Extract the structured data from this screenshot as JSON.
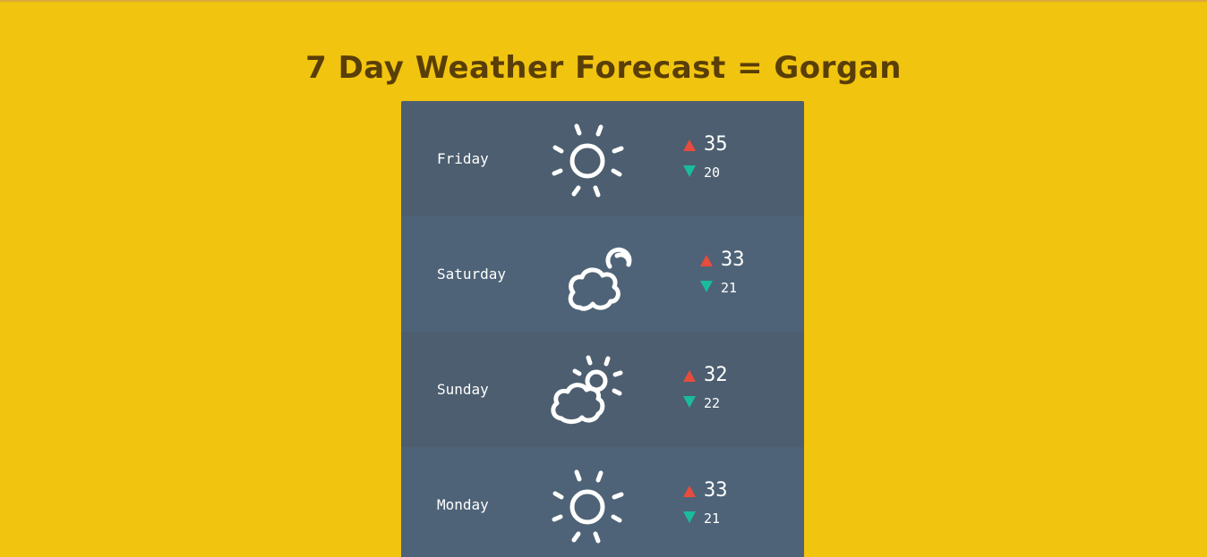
{
  "page": {
    "title": "7 Day Weather Forecast = Gorgan"
  },
  "colors": {
    "background": "#f1c40f",
    "title": "#5a3e07",
    "row_dark": "#4c5e6f",
    "row_light": "#4e6377",
    "high_arrow": "#e74c3c",
    "low_arrow": "#1abc9c",
    "text": "#ffffff"
  },
  "forecast": [
    {
      "day": "Friday",
      "icon": "sun-icon",
      "high": "35",
      "low": "20"
    },
    {
      "day": "Saturday",
      "icon": "cloud-moon-icon",
      "high": "33",
      "low": "21"
    },
    {
      "day": "Sunday",
      "icon": "partly-cloudy-icon",
      "high": "32",
      "low": "22"
    },
    {
      "day": "Monday",
      "icon": "sun-icon",
      "high": "33",
      "low": "21"
    }
  ]
}
